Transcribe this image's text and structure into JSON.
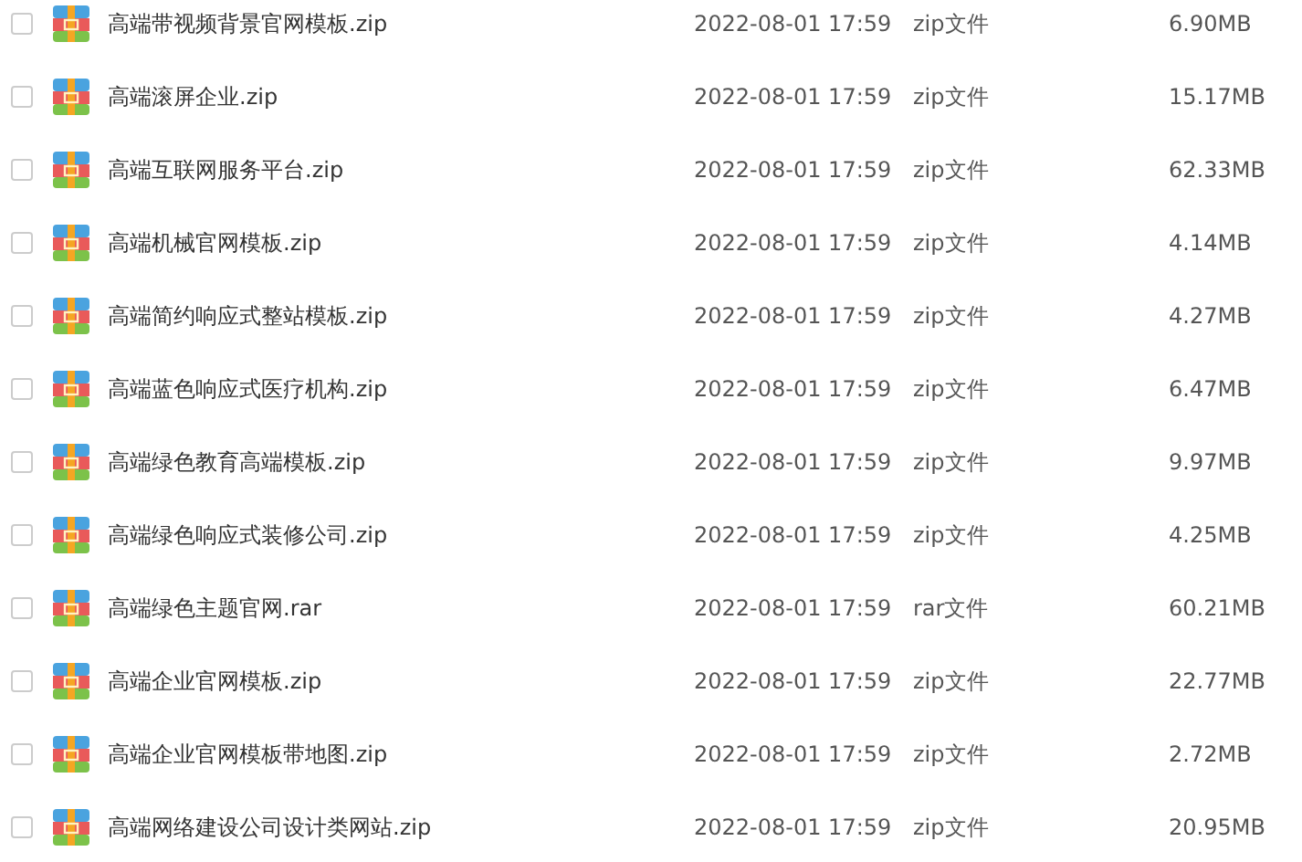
{
  "files": [
    {
      "name": "高端带视频背景官网模板.zip",
      "date": "2022-08-01 17:59",
      "type": "zip文件",
      "size": "6.90MB",
      "checked": false
    },
    {
      "name": "高端滚屏企业.zip",
      "date": "2022-08-01 17:59",
      "type": "zip文件",
      "size": "15.17MB",
      "checked": false
    },
    {
      "name": "高端互联网服务平台.zip",
      "date": "2022-08-01 17:59",
      "type": "zip文件",
      "size": "62.33MB",
      "checked": false
    },
    {
      "name": "高端机械官网模板.zip",
      "date": "2022-08-01 17:59",
      "type": "zip文件",
      "size": "4.14MB",
      "checked": false
    },
    {
      "name": "高端简约响应式整站模板.zip",
      "date": "2022-08-01 17:59",
      "type": "zip文件",
      "size": "4.27MB",
      "checked": false
    },
    {
      "name": "高端蓝色响应式医疗机构.zip",
      "date": "2022-08-01 17:59",
      "type": "zip文件",
      "size": "6.47MB",
      "checked": false
    },
    {
      "name": "高端绿色教育高端模板.zip",
      "date": "2022-08-01 17:59",
      "type": "zip文件",
      "size": "9.97MB",
      "checked": false
    },
    {
      "name": "高端绿色响应式装修公司.zip",
      "date": "2022-08-01 17:59",
      "type": "zip文件",
      "size": "4.25MB",
      "checked": false
    },
    {
      "name": "高端绿色主题官网.rar",
      "date": "2022-08-01 17:59",
      "type": "rar文件",
      "size": "60.21MB",
      "checked": false
    },
    {
      "name": "高端企业官网模板.zip",
      "date": "2022-08-01 17:59",
      "type": "zip文件",
      "size": "22.77MB",
      "checked": false
    },
    {
      "name": "高端企业官网模板带地图.zip",
      "date": "2022-08-01 17:59",
      "type": "zip文件",
      "size": "2.72MB",
      "checked": false
    },
    {
      "name": "高端网络建设公司设计类网站.zip",
      "date": "2022-08-01 17:59",
      "type": "zip文件",
      "size": "20.95MB",
      "checked": false
    }
  ]
}
